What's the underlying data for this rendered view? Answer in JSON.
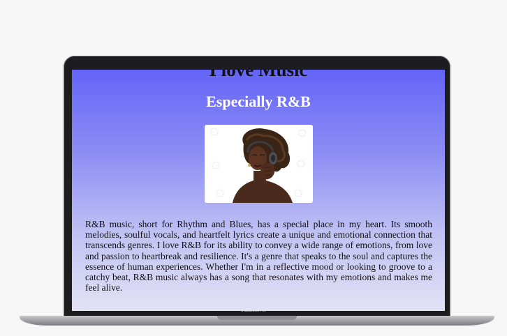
{
  "page": {
    "title": "I love Music",
    "subtitle": "Especially R&B",
    "image_alt": "Woman listening to music on headphones",
    "body": "R&B music, short for Rhythm and Blues, has a special place in my heart. Its smooth melodies, soulful vocals, and heartfelt lyrics create a unique and emotional connection that transcends genres. I love R&B for its ability to convey a wide range of emotions, from love and passion to heartbreak and resilience. It's a genre that speaks to the soul and captures the essence of human experiences. Whether I'm in a reflective mood or looking to groove to a catchy beat, R&B music always has a song that resonates with my emotions and makes me feel alive."
  },
  "device": {
    "label": "MacBook Air"
  },
  "colors": {
    "gradient_top": "#6464f8",
    "gradient_bottom": "#e2e2f5",
    "subtitle": "#ffffff",
    "bezel": "#1d1d1f"
  }
}
